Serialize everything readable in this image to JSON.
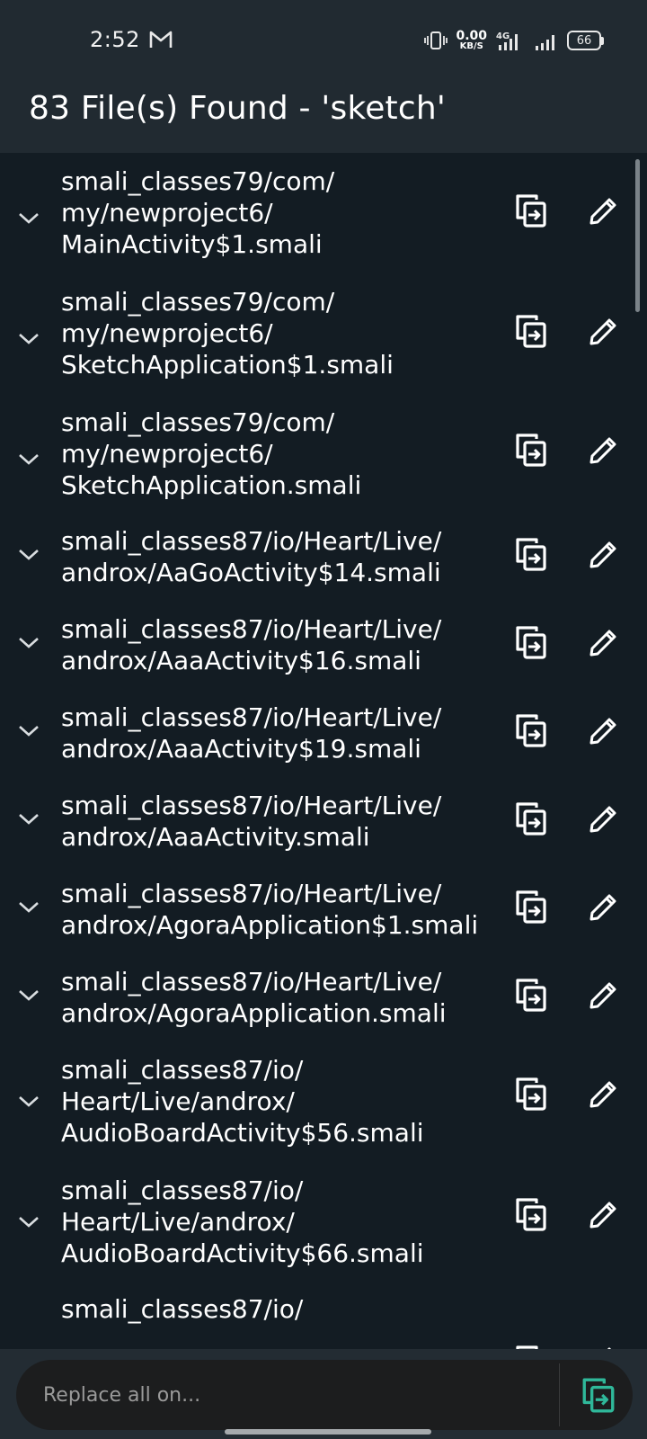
{
  "status_bar": {
    "time": "2:52",
    "net_speed_value": "0.00",
    "net_speed_unit": "KB/S",
    "network_type": "4G",
    "battery_level": "66",
    "icons": [
      "gmail-icon",
      "vibrate-icon",
      "signal-4g-icon",
      "signal-icon"
    ]
  },
  "app_bar": {
    "title": "83 File(s) Found - 'sketch'"
  },
  "results": [
    {
      "lines": [
        "smali_classes79/com/",
        "my/newproject6/",
        "MainActivity$1.smali"
      ]
    },
    {
      "lines": [
        "smali_classes79/com/",
        "my/newproject6/",
        "SketchApplication$1.smali"
      ]
    },
    {
      "lines": [
        "smali_classes79/com/",
        "my/newproject6/",
        "SketchApplication.smali"
      ]
    },
    {
      "lines": [
        "smali_classes87/io/Heart/Live/",
        "androx/AaGoActivity$14.smali"
      ]
    },
    {
      "lines": [
        "smali_classes87/io/Heart/Live/",
        "androx/AaaActivity$16.smali"
      ]
    },
    {
      "lines": [
        "smali_classes87/io/Heart/Live/",
        "androx/AaaActivity$19.smali"
      ]
    },
    {
      "lines": [
        "smali_classes87/io/Heart/Live/",
        "androx/AaaActivity.smali"
      ]
    },
    {
      "lines": [
        "smali_classes87/io/Heart/Live/",
        "androx/AgoraApplication$1.smali"
      ]
    },
    {
      "lines": [
        "smali_classes87/io/Heart/Live/",
        "androx/AgoraApplication.smali"
      ]
    },
    {
      "lines": [
        "smali_classes87/io/",
        "Heart/Live/androx/",
        "AudioBoardActivity$56.smali"
      ]
    },
    {
      "lines": [
        "smali_classes87/io/",
        "Heart/Live/androx/",
        "AudioBoardActivity$66.smali"
      ]
    },
    {
      "lines": [
        "smali_classes87/io/"
      ]
    }
  ],
  "replace_bar": {
    "placeholder": "Replace all on...",
    "accent_color": "#2fb89a"
  },
  "colors": {
    "background": "#131c23",
    "app_bar": "#212a31",
    "text": "#ffffff"
  }
}
